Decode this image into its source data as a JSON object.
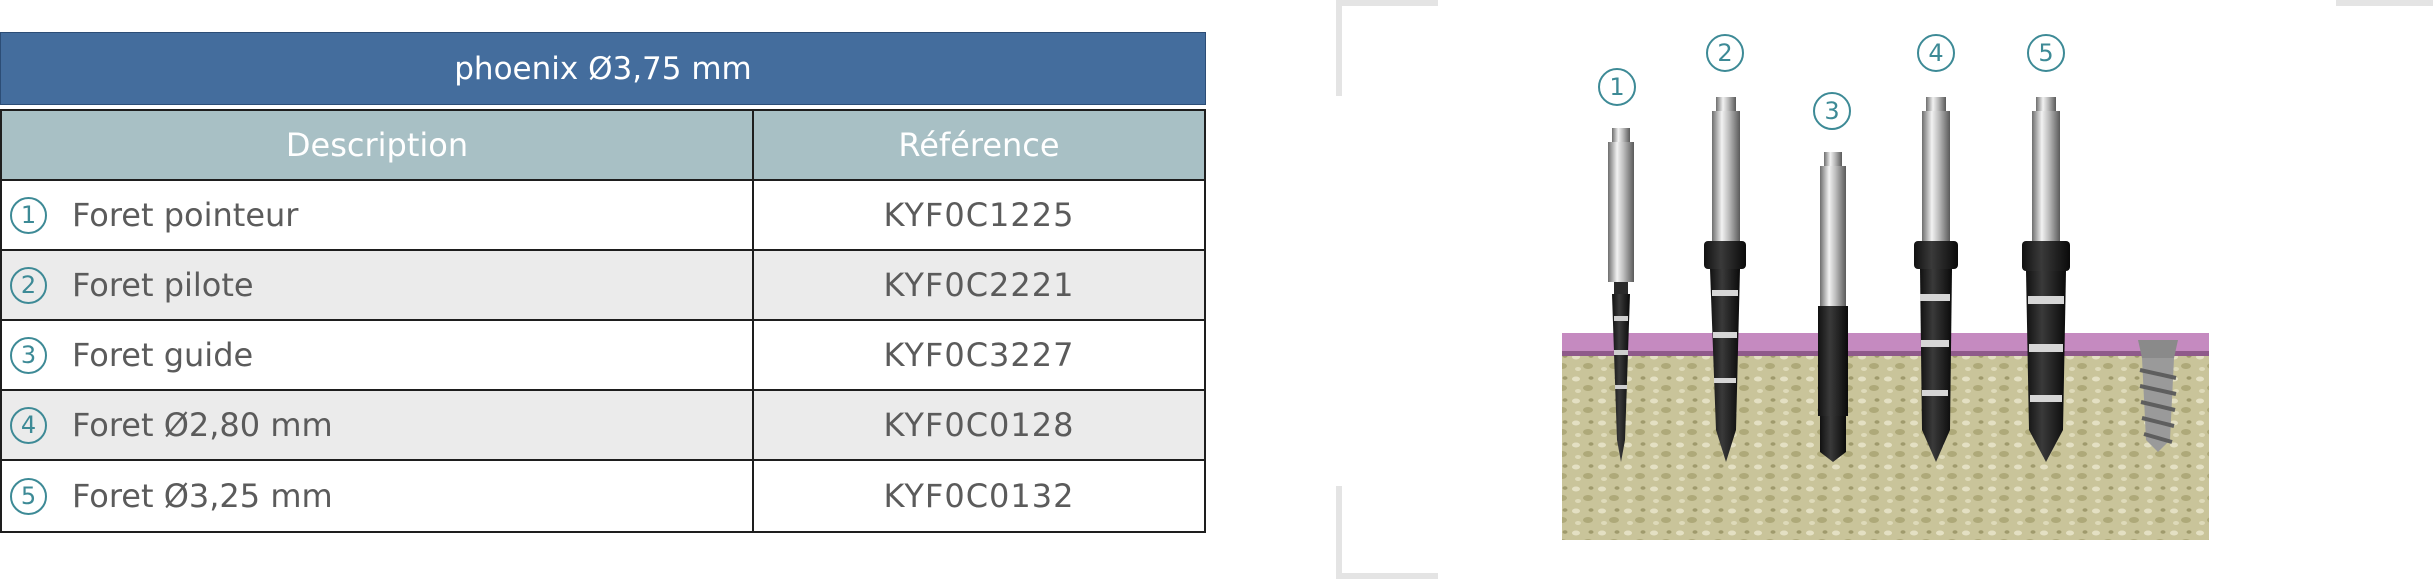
{
  "table": {
    "title": "phoenix Ø3,75 mm",
    "headers": {
      "description": "Description",
      "reference": "Référence"
    },
    "rows": [
      {
        "num": "1",
        "description": "Foret pointeur",
        "reference": "KYF0C1225"
      },
      {
        "num": "2",
        "description": "Foret pilote",
        "reference": "KYF0C2221"
      },
      {
        "num": "3",
        "description": "Foret guide",
        "reference": "KYF0C3227"
      },
      {
        "num": "4",
        "description": "Foret Ø2,80 mm",
        "reference": "KYF0C0128"
      },
      {
        "num": "5",
        "description": "Foret Ø3,25 mm",
        "reference": "KYF0C0132"
      }
    ]
  },
  "illustration": {
    "labels": [
      "1",
      "2",
      "3",
      "4",
      "5"
    ],
    "colors": {
      "header": "#446d9d",
      "subheader": "#a8c0c5",
      "accent": "#3d8a96",
      "gum": "#c58ac0",
      "bone": "#c9c49a"
    }
  }
}
